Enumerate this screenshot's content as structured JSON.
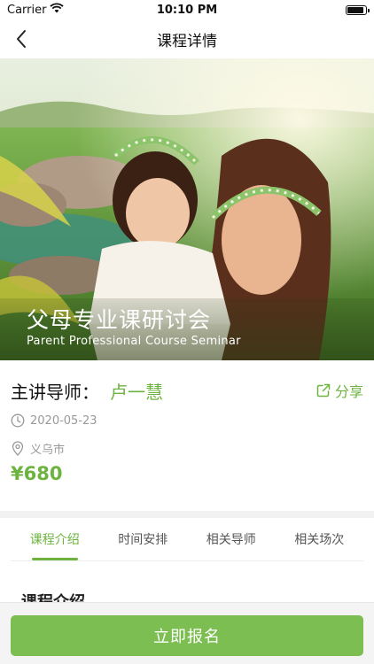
{
  "status_bar": {
    "carrier": "Carrier",
    "time": "10:10 PM",
    "battery_level": 0.9,
    "wifi_icon": "wifi-icon",
    "battery_icon": "battery-icon"
  },
  "nav": {
    "title": "课程详情",
    "back_icon": "chevron-left-icon"
  },
  "hero": {
    "title": "父母专业课研讨会",
    "subtitle": "Parent Professional Course Seminar"
  },
  "course": {
    "teacher_label": "主讲导师：",
    "teacher_name": "卢一慧",
    "share_label": "分享",
    "share_icon": "share-icon",
    "date": "2020-05-23",
    "date_icon": "clock-icon",
    "location": "义乌市",
    "location_icon": "location-pin-icon",
    "price": "¥680"
  },
  "tabs": [
    {
      "label": "课程介绍",
      "active": true
    },
    {
      "label": "时间安排",
      "active": false
    },
    {
      "label": "相关导师",
      "active": false
    },
    {
      "label": "相关场次",
      "active": false
    }
  ],
  "content": {
    "section_title": "课程介绍"
  },
  "footer": {
    "signup_label": "立即报名"
  },
  "colors": {
    "accent": "#6db33f",
    "button": "#7cbe52",
    "muted_text": "#999999"
  }
}
